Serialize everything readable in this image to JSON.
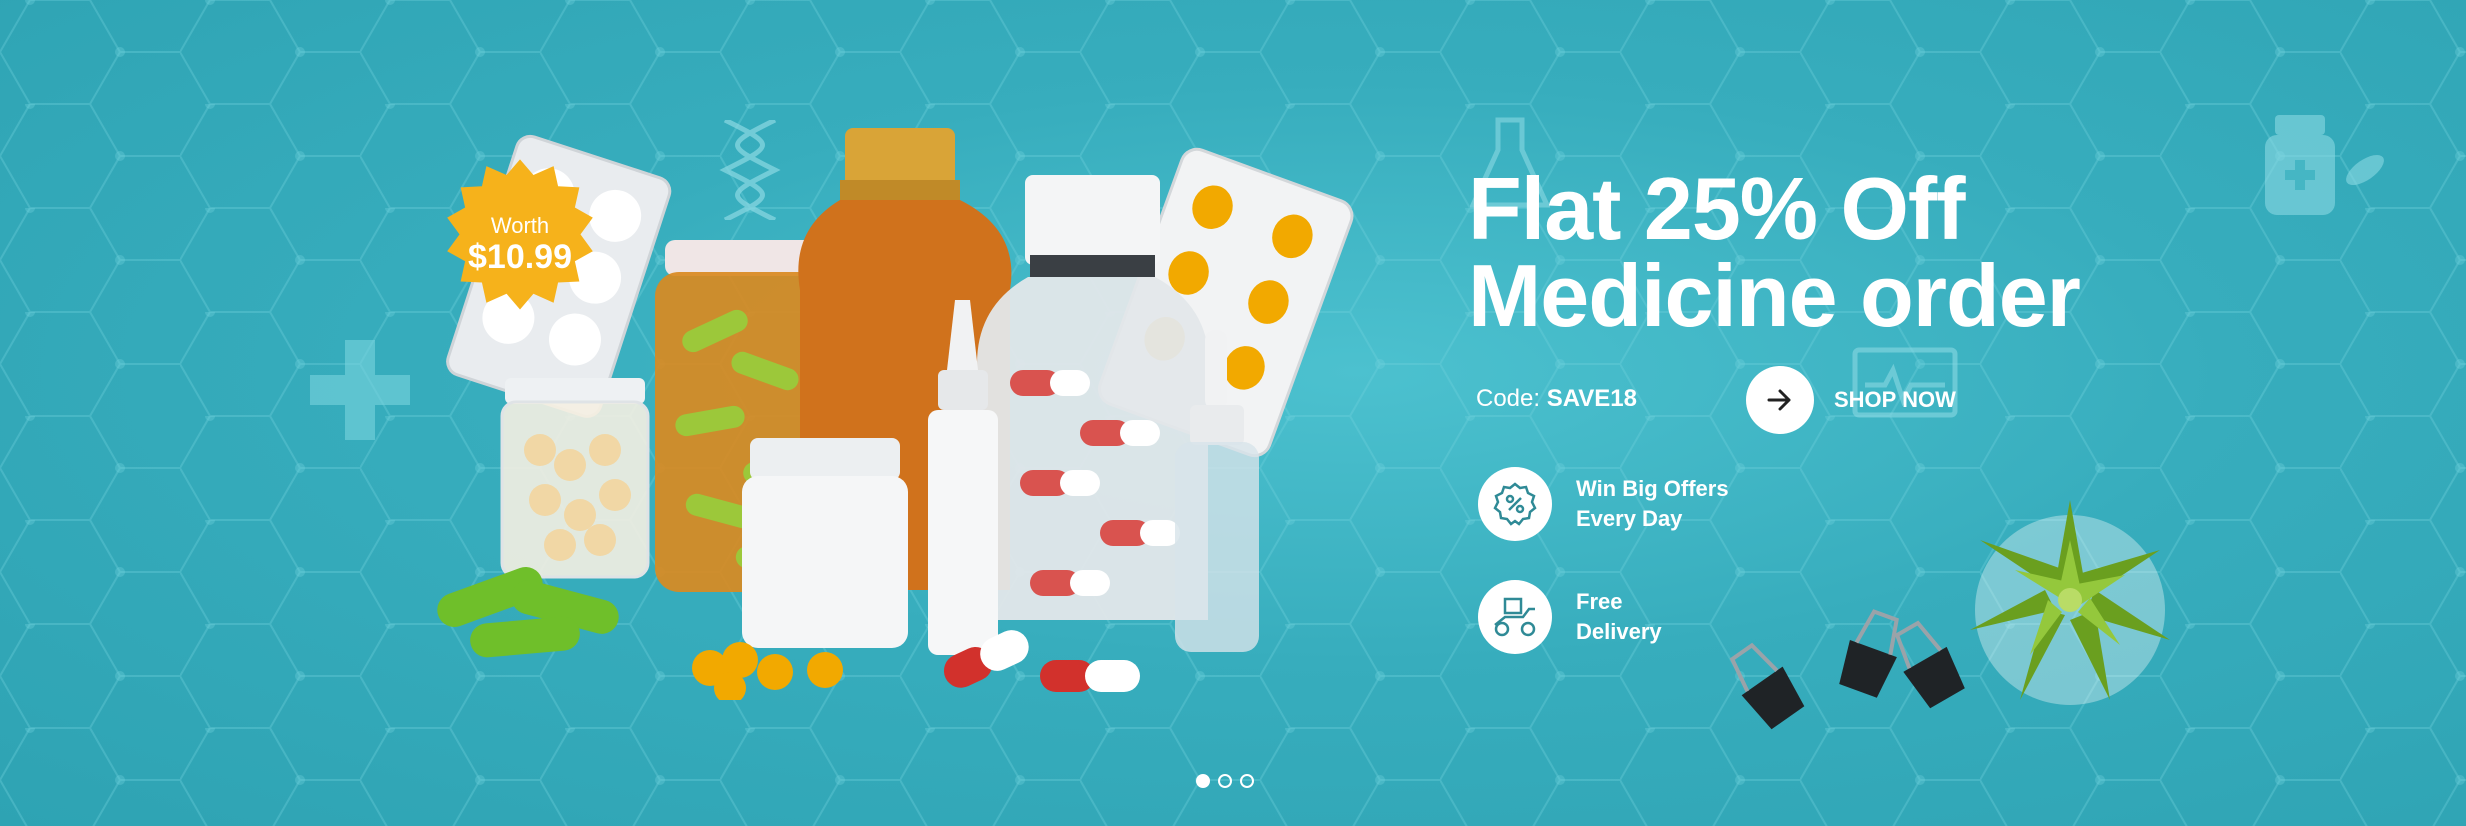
{
  "banner": {
    "headline_line1": "Flat 25% Off",
    "headline_line2": "Medicine order",
    "code_label": "Code:",
    "code_value": "SAVE18",
    "shop_label": "SHOP NOW",
    "badge_line1": "Worth",
    "badge_line2": "$10.99",
    "features": [
      {
        "icon": "percent-badge-icon",
        "text": "Win Big Offers\nEvery Day"
      },
      {
        "icon": "delivery-scooter-icon",
        "text": "Free\nDelivery"
      }
    ]
  },
  "carousel": {
    "slides": 3,
    "active": 0
  },
  "colors": {
    "background": "#37adbd",
    "badge": "#f6b21b",
    "accent": "#2b2b2b"
  }
}
